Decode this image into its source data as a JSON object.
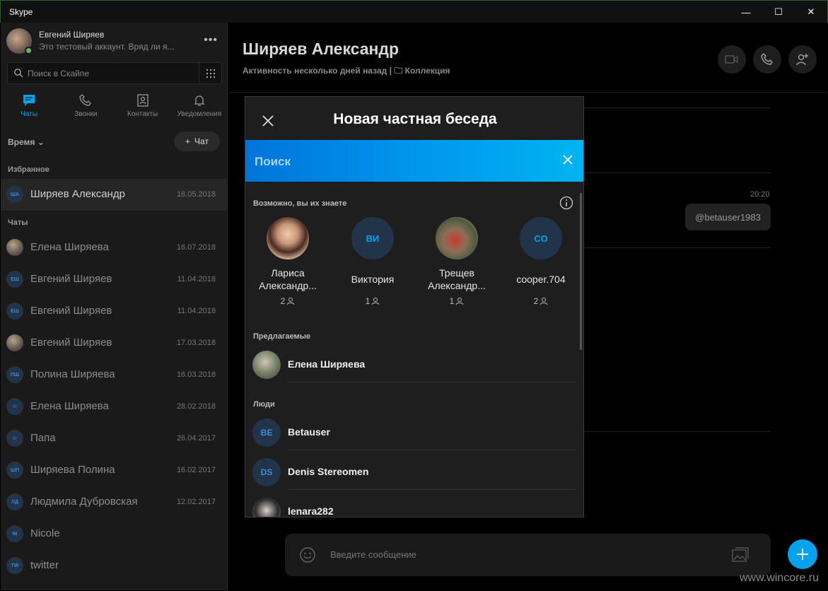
{
  "window": {
    "title": "Skype",
    "minimize": "—",
    "maximize": "☐",
    "close": "✕"
  },
  "profile": {
    "name": "Евгений Ширяев",
    "status": "Это тестовый аккаунт. Вряд ли я...",
    "more": "•••"
  },
  "search": {
    "placeholder": "Поиск в Скайпе"
  },
  "nav": {
    "chats": "Чаты",
    "calls": "Звонки",
    "contacts": "Контакты",
    "notifications": "Уведомления"
  },
  "sort": {
    "label": "Время"
  },
  "new_chat": {
    "label": "Чат"
  },
  "sections": {
    "favorites": "Избранное",
    "chats": "Чаты"
  },
  "favorites": [
    {
      "initials": "ША",
      "name": "Ширяев Александр",
      "date": "18.05.2018"
    }
  ],
  "chats": [
    {
      "initials": "",
      "name": "Елена Ширяева",
      "date": "16.07.2018"
    },
    {
      "initials": "ЕШ",
      "name": "Евгений Ширяев",
      "date": "11.04.2018"
    },
    {
      "initials": "ЕШ",
      "name": "Евгений Ширяев",
      "date": "11.04.2018"
    },
    {
      "initials": "",
      "name": "Евгений Ширяев",
      "date": "17.03.2018"
    },
    {
      "initials": "ПШ",
      "name": "Полина Ширяева",
      "date": "16.03.2018"
    },
    {
      "initials": "☏",
      "name": "Елена Ширяева",
      "date": "28.02.2018"
    },
    {
      "initials": "☏",
      "name": "Папа",
      "date": "26.04.2017"
    },
    {
      "initials": "ШП",
      "name": "Ширяева Полина",
      "date": "16.02.2017"
    },
    {
      "initials": "ЛД",
      "name": "Людмила Дубровская",
      "date": "12.02.2017"
    },
    {
      "initials": "NI",
      "name": "Nicole",
      "date": ""
    },
    {
      "initials": "TW",
      "name": "twitter",
      "date": ""
    }
  ],
  "conversation": {
    "name": "Ширяев Александр",
    "activity": "Активность несколько дней назад",
    "separator": "|",
    "collection": "Коллекция",
    "message_time": "20:20",
    "message_text": "@betauser1983",
    "composer_placeholder": "Введите сообщение"
  },
  "modal": {
    "title": "Новая частная беседа",
    "search_placeholder": "Поиск",
    "maybe_know_title": "Возможно, вы их знаете",
    "maybe_know": [
      {
        "initials": "",
        "name": "Лариса Александр...",
        "count": "2"
      },
      {
        "initials": "ВИ",
        "name": "Виктория",
        "count": "1"
      },
      {
        "initials": "",
        "name": "Трещев Александр...",
        "count": "1"
      },
      {
        "initials": "CO",
        "name": "cooper.704",
        "count": "2"
      }
    ],
    "suggested_title": "Предлагаемые",
    "suggested": [
      {
        "initials": "",
        "name": "Елена Ширяева"
      }
    ],
    "people_title": "Люди",
    "people": [
      {
        "initials": "BE",
        "name": "Betauser"
      },
      {
        "initials": "DS",
        "name": "Denis Stereomen"
      },
      {
        "initials": "",
        "name": "lenara282"
      }
    ]
  },
  "watermark": "www.wincore.ru",
  "colors": {
    "accent": "#00a2ed",
    "sidebar_bg": "#1a1a1a",
    "modal_bg": "#1e1e1e",
    "presence": "#5cb85c"
  }
}
